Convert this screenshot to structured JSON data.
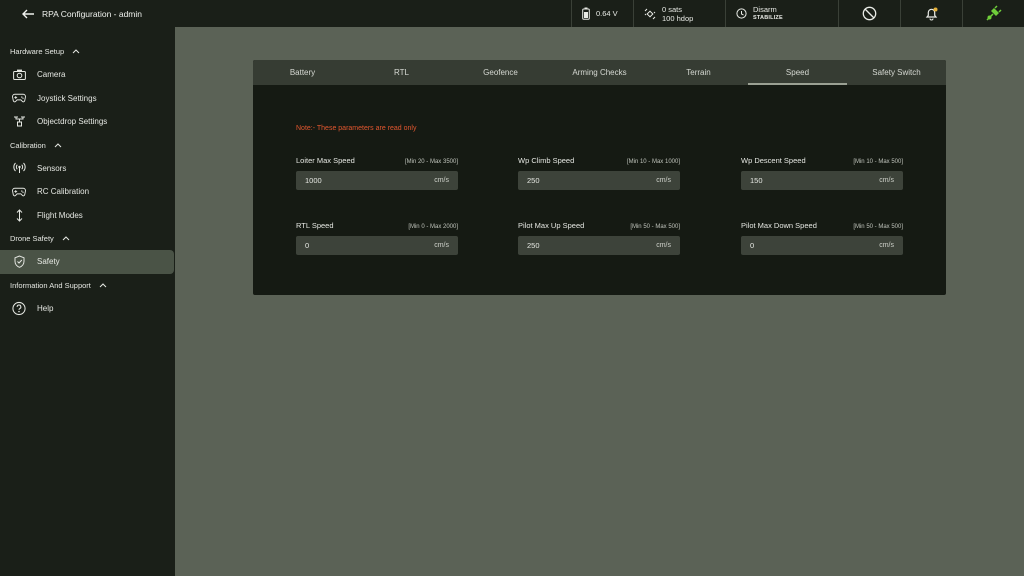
{
  "header": {
    "title": "RPA Configuration - admin",
    "battery": "0.64 V",
    "sats": "0 sats",
    "hdop": "100 hdop",
    "arm_state": "Disarm",
    "flight_mode": "STABILIZE"
  },
  "sidebar": {
    "sections": [
      {
        "title": "Hardware Setup",
        "items": [
          "Camera",
          "Joystick Settings",
          "Objectdrop Settings"
        ]
      },
      {
        "title": "Calibration",
        "items": [
          "Sensors",
          "RC Calibration",
          "Flight Modes"
        ]
      },
      {
        "title": "Drone Safety",
        "items": [
          "Safety"
        ]
      },
      {
        "title": "Information And Support",
        "items": [
          "Help"
        ]
      }
    ]
  },
  "tabs": [
    "Battery",
    "RTL",
    "Geofence",
    "Arming Checks",
    "Terrain",
    "Speed",
    "Safety Switch"
  ],
  "active_tab": "Speed",
  "note": "Note:- These parameters are read only",
  "fields": [
    {
      "label": "Loiter Max Speed",
      "range": "[Min 20 - Max 3500]",
      "value": "1000",
      "unit": "cm/s"
    },
    {
      "label": "Wp Climb Speed",
      "range": "[Min 10 - Max 1000]",
      "value": "250",
      "unit": "cm/s"
    },
    {
      "label": "Wp Descent Speed",
      "range": "[Min 10 - Max 500]",
      "value": "150",
      "unit": "cm/s"
    },
    {
      "label": "RTL Speed",
      "range": "[Min 0 - Max 2000]",
      "value": "0",
      "unit": "cm/s"
    },
    {
      "label": "Pilot Max Up Speed",
      "range": "[Min 50 - Max 500]",
      "value": "250",
      "unit": "cm/s"
    },
    {
      "label": "Pilot Max Down Speed",
      "range": "[Min 50 - Max 500]",
      "value": "0",
      "unit": "cm/s"
    }
  ],
  "colors": {
    "note": "#e2572f",
    "link_icon": "#6fcf3a",
    "sidebar_bg": "#1a1f18",
    "content_bg": "#5b6256"
  }
}
